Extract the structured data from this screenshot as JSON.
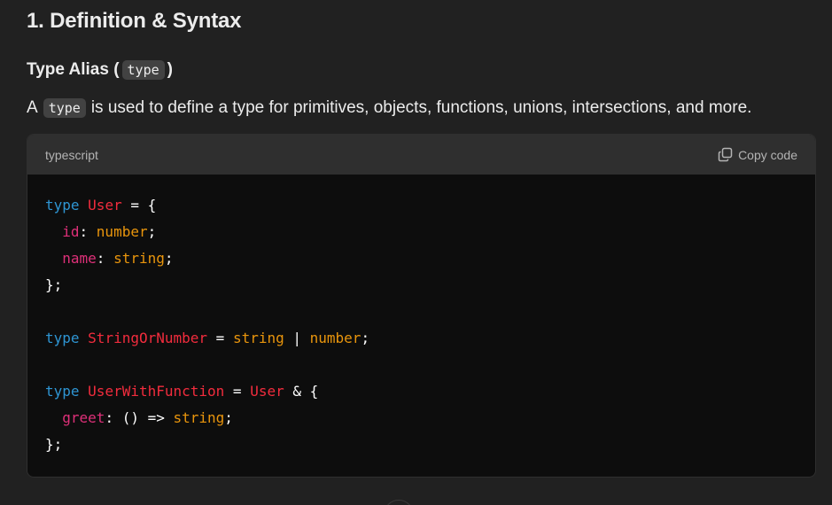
{
  "heading": "1. Definition & Syntax",
  "subheading": {
    "prefix": "Type Alias (",
    "code": "type",
    "suffix": ")"
  },
  "paragraph": {
    "before": "A",
    "code": "type",
    "after": "is used to define a type for primitives, objects, functions, unions, intersections, and more."
  },
  "codeblock": {
    "language": "typescript",
    "copy_label": "Copy code",
    "copy_icon": "copy-icon",
    "lines": [
      [
        {
          "t": "kw",
          "v": "type"
        },
        {
          "t": "pn",
          "v": " "
        },
        {
          "t": "tname",
          "v": "User"
        },
        {
          "t": "pn",
          "v": " = {"
        }
      ],
      [
        {
          "t": "pn",
          "v": "  "
        },
        {
          "t": "tn",
          "v": "id"
        },
        {
          "t": "pn",
          "v": ": "
        },
        {
          "t": "pt",
          "v": "number"
        },
        {
          "t": "pn",
          "v": ";"
        }
      ],
      [
        {
          "t": "pn",
          "v": "  "
        },
        {
          "t": "tn",
          "v": "name"
        },
        {
          "t": "pn",
          "v": ": "
        },
        {
          "t": "pt",
          "v": "string"
        },
        {
          "t": "pn",
          "v": ";"
        }
      ],
      [
        {
          "t": "pn",
          "v": "};"
        }
      ],
      [],
      [
        {
          "t": "kw",
          "v": "type"
        },
        {
          "t": "pn",
          "v": " "
        },
        {
          "t": "tname",
          "v": "StringOrNumber"
        },
        {
          "t": "pn",
          "v": " = "
        },
        {
          "t": "pt",
          "v": "string"
        },
        {
          "t": "pn",
          "v": " | "
        },
        {
          "t": "pt",
          "v": "number"
        },
        {
          "t": "pn",
          "v": ";"
        }
      ],
      [],
      [
        {
          "t": "kw",
          "v": "type"
        },
        {
          "t": "pn",
          "v": " "
        },
        {
          "t": "tname",
          "v": "UserWithFunction"
        },
        {
          "t": "pn",
          "v": " = "
        },
        {
          "t": "tname",
          "v": "User"
        },
        {
          "t": "pn",
          "v": " & {"
        }
      ],
      [
        {
          "t": "pn",
          "v": "  "
        },
        {
          "t": "tn",
          "v": "greet"
        },
        {
          "t": "pn",
          "v": ": () => "
        },
        {
          "t": "pt",
          "v": "string"
        },
        {
          "t": "pn",
          "v": ";"
        }
      ],
      [
        {
          "t": "pn",
          "v": "};"
        }
      ]
    ]
  },
  "colors": {
    "background": "#212121",
    "code_background": "#0d0d0d",
    "header_background": "#2f2f2f",
    "keyword": "#2e95d3",
    "type_name": "#f22c3d",
    "property": "#df3079",
    "primitive": "#e9950c"
  }
}
